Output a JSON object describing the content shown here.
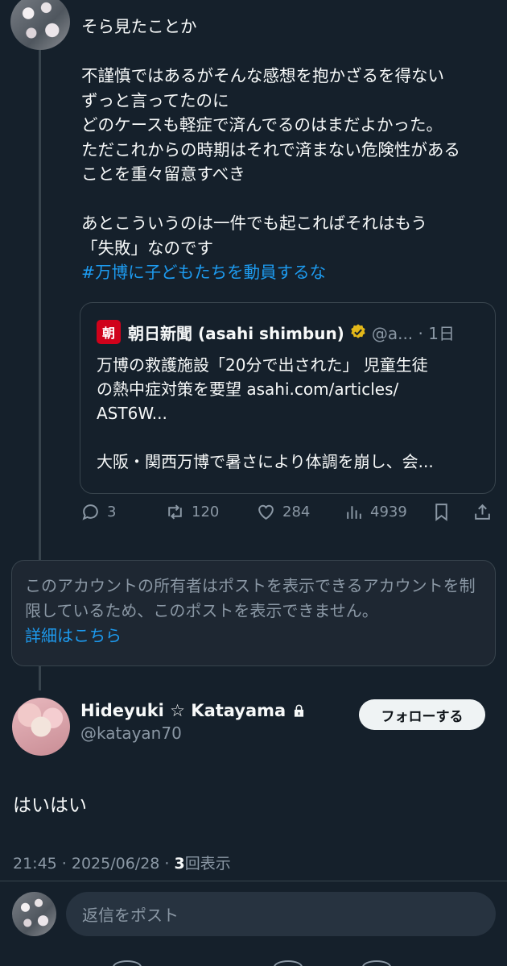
{
  "thread": {
    "post_lines": [
      "そら見たことか",
      "",
      "不謹慎ではあるがそんな感想を抱かざるを得ない",
      "ずっと言ってたのに",
      "どのケースも軽症で済んでるのはまだよかった。",
      "ただこれからの時期はそれで済まない危険性がある",
      "ことを重々留意すべき",
      "",
      "あとこういうのは一件でも起こればそれはもう",
      "「失敗」なのです"
    ],
    "hashtag": "#万博に子どもたちを動員するな",
    "quote": {
      "logo_text": "朝",
      "name": "朝日新聞 (asahi shimbun)",
      "handle": "@a... · 1日",
      "body": "万博の救護施設「20分で出された」 児童生徒\nの熱中症対策を要望 asahi.com/articles/\nAST6W...\n\n大阪・関西万博で暑さにより体調を崩し、会...",
      "verified_color": "#e2b719"
    },
    "actions": {
      "replies": "3",
      "reposts": "120",
      "likes": "284",
      "views": "4939"
    }
  },
  "restricted": {
    "message": "このアカウントの所有者はポストを表示できるアカウントを制限しているため、このポストを表示できません。",
    "link": "詳細はこちら"
  },
  "main_post": {
    "author_name": "Hideyuki ☆ Katayama",
    "author_handle": "@katayan70",
    "follow_label": "フォローする",
    "text": "はいはい",
    "timestamp": "21:45 · 2025/06/28 · ",
    "view_count": "3",
    "view_label": "回表示"
  },
  "reply": {
    "placeholder": "返信をポスト"
  }
}
